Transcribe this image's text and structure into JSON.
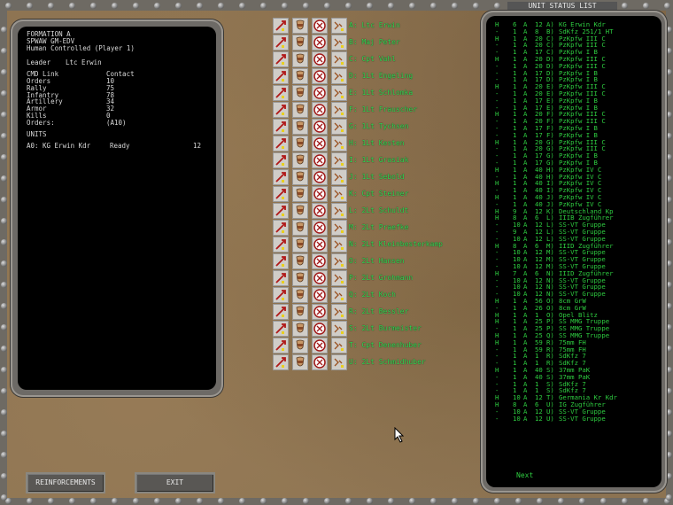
{
  "left_panel": {
    "formation": "FORMATION A",
    "game_id": "SPWAW GM-EDV",
    "control": "Human Controlled (Player 1)",
    "leader_label": "Leader",
    "leader_name": "Ltc Erwin",
    "cmd_link_label": "CMD Link",
    "cmd_link_value": "Contact",
    "stats": [
      {
        "label": "Orders",
        "value": "10"
      },
      {
        "label": "Rally",
        "value": "75"
      },
      {
        "label": "Infantry",
        "value": "78"
      },
      {
        "label": "Artillery",
        "value": "34"
      },
      {
        "label": "Armor",
        "value": "32"
      },
      {
        "label": "Kills",
        "value": "0"
      },
      {
        "label": "Orders:",
        "value": "(A10)"
      }
    ],
    "units_heading": "UNITS",
    "unit_line": {
      "id": "A0:",
      "name": "KG Erwin Kdr",
      "status": "Ready",
      "count": "12"
    }
  },
  "units": [
    "A: Ltc Erwin",
    "B: Maj Peter",
    "C: Cpt Vahl",
    "D: 1Lt Engeling",
    "E: 1Lt Schlomka",
    "F: 1Lt Frauscher",
    "G: 1Lt Tychsen",
    "H: 1Lt Kesten",
    "I: 1Lt Grasiak",
    "J: 1Lt Sebold",
    "K: Cpt Steiner",
    "L: 2Lt Schuldt",
    "M: 2Lt Praefke",
    "N: 2Lt Kleinbesterkamp",
    "O: 2Lt Hansen",
    "P: 2Lt Grohmann",
    "Q: 2Lt Koch",
    "R: 2Lt Bessler",
    "S: 2Lt Burmeister",
    "T: Cpt Denenhuber",
    "U: 2Lt Schmidhuber"
  ],
  "status_panel": {
    "title": "UNIT STATUS LIST",
    "next": "Next",
    "rows": [
      [
        "H",
        "6",
        "A",
        "12",
        "A)",
        "KG Erwin Kdr"
      ],
      [
        "-",
        "1",
        "A",
        "8",
        "B)",
        "SdKfz 251/1 HT"
      ],
      [
        "H",
        "1",
        "A",
        "20",
        "C)",
        "PzKpfw III C"
      ],
      [
        "-",
        "1",
        "A",
        "20",
        "C)",
        "PzKpfw III C"
      ],
      [
        "-",
        "1",
        "A",
        "17",
        "C)",
        "PzKpfw I B"
      ],
      [
        "H",
        "1",
        "A",
        "20",
        "D)",
        "PzKpfw III C"
      ],
      [
        "-",
        "1",
        "A",
        "20",
        "D)",
        "PzKpfw III C"
      ],
      [
        "-",
        "1",
        "A",
        "17",
        "D)",
        "PzKpfw I B"
      ],
      [
        "-",
        "1",
        "A",
        "17",
        "D)",
        "PzKpfw I B"
      ],
      [
        "H",
        "1",
        "A",
        "20",
        "E)",
        "PzKpfw III C"
      ],
      [
        "-",
        "1",
        "A",
        "20",
        "E)",
        "PzKpfw III C"
      ],
      [
        "-",
        "1",
        "A",
        "17",
        "E)",
        "PzKpfw I B"
      ],
      [
        "-",
        "1",
        "A",
        "17",
        "E)",
        "PzKpfw I B"
      ],
      [
        "H",
        "1",
        "A",
        "20",
        "F)",
        "PzKpfw III C"
      ],
      [
        "-",
        "1",
        "A",
        "20",
        "F)",
        "PzKpfw III C"
      ],
      [
        "-",
        "1",
        "A",
        "17",
        "F)",
        "PzKpfw I B"
      ],
      [
        "-",
        "1",
        "A",
        "17",
        "F)",
        "PzKpfw I B"
      ],
      [
        "H",
        "1",
        "A",
        "20",
        "G)",
        "PzKpfw III C"
      ],
      [
        "-",
        "1",
        "A",
        "20",
        "G)",
        "PzKpfw III C"
      ],
      [
        "-",
        "1",
        "A",
        "17",
        "G)",
        "PzKpfw I B"
      ],
      [
        "-",
        "1",
        "A",
        "17",
        "G)",
        "PzKpfw I B"
      ],
      [
        "H",
        "1",
        "A",
        "40",
        "H)",
        "PzKpfw IV C"
      ],
      [
        "-",
        "1",
        "A",
        "40",
        "H)",
        "PzKpfw IV C"
      ],
      [
        "H",
        "1",
        "A",
        "40",
        "I)",
        "PzKpfw IV C"
      ],
      [
        "-",
        "1",
        "A",
        "40",
        "I)",
        "PzKpfw IV C"
      ],
      [
        "H",
        "1",
        "A",
        "40",
        "J)",
        "PzKpfw IV C"
      ],
      [
        "-",
        "1",
        "A",
        "40",
        "J)",
        "PzKpfw IV C"
      ],
      [
        "H",
        "9",
        "A",
        "12",
        "K)",
        "Deutschland Kp"
      ],
      [
        "H",
        "8",
        "A",
        "6",
        "L)",
        "IIIB Zugführer"
      ],
      [
        "-",
        "10",
        "A",
        "12",
        "L)",
        "SS-VT Gruppe"
      ],
      [
        "-",
        "9",
        "A",
        "12",
        "L)",
        "SS-VT Gruppe"
      ],
      [
        "-",
        "10",
        "A",
        "12",
        "L)",
        "SS-VT Gruppe"
      ],
      [
        "H",
        "8",
        "A",
        "6",
        "M)",
        "IIID Zugführer"
      ],
      [
        "-",
        "10",
        "A",
        "12",
        "M)",
        "SS-VT Gruppe"
      ],
      [
        "-",
        "10",
        "A",
        "12",
        "M)",
        "SS-VT Gruppe"
      ],
      [
        "-",
        "10",
        "A",
        "12",
        "M)",
        "SS-VT Gruppe"
      ],
      [
        "H",
        "7",
        "A",
        "6",
        "N)",
        "IIID Zugführer"
      ],
      [
        "-",
        "10",
        "A",
        "12",
        "N)",
        "SS-VT Gruppe"
      ],
      [
        "-",
        "10",
        "A",
        "12",
        "N)",
        "SS-VT Gruppe"
      ],
      [
        "-",
        "10",
        "A",
        "12",
        "N)",
        "SS-VT Gruppe"
      ],
      [
        "H",
        "1",
        "A",
        "56",
        "O)",
        "8cm GrW"
      ],
      [
        "-",
        "1",
        "A",
        "26",
        "O)",
        "8cm GrW"
      ],
      [
        "H",
        "1",
        "A",
        "1",
        "O)",
        "Opel Blitz"
      ],
      [
        "H",
        "1",
        "A",
        "25",
        "P)",
        "SS MMG Truppe"
      ],
      [
        "-",
        "1",
        "A",
        "25",
        "P)",
        "SS MMG Truppe"
      ],
      [
        "H",
        "1",
        "A",
        "25",
        "Q)",
        "SS MMG Truppe"
      ],
      [
        "H",
        "1",
        "A",
        "59",
        "R)",
        "75mm FH"
      ],
      [
        "-",
        "1",
        "A",
        "59",
        "R)",
        "75mm FH"
      ],
      [
        "-",
        "1",
        "A",
        "1",
        "R)",
        "SdKfz 7"
      ],
      [
        "-",
        "1",
        "A",
        "1",
        "R)",
        "SdKfz 7"
      ],
      [
        "H",
        "1",
        "A",
        "40",
        "S)",
        "37mm PaK"
      ],
      [
        "-",
        "1",
        "A",
        "40",
        "S)",
        "37mm PaK"
      ],
      [
        "-",
        "1",
        "A",
        "1",
        "S)",
        "SdKfz 7"
      ],
      [
        "-",
        "1",
        "A",
        "1",
        "S)",
        "SdKfz 7"
      ],
      [
        "H",
        "10",
        "A",
        "12",
        "T)",
        "Germania Kr Kdr"
      ],
      [
        "H",
        "8",
        "A",
        "6",
        "U)",
        "IG Zugführer"
      ],
      [
        "-",
        "10",
        "A",
        "12",
        "U)",
        "SS-VT Gruppe"
      ],
      [
        "-",
        "10",
        "A",
        "12",
        "U)",
        "SS-VT Gruppe"
      ]
    ]
  },
  "buttons": {
    "reinforcements": "REINFORCEMENTS",
    "exit": "EXIT"
  },
  "colors": {
    "terminal_green": "#2ecc40",
    "unit_label_green": "#33dd55",
    "panel_frame": "#6d6a66"
  }
}
